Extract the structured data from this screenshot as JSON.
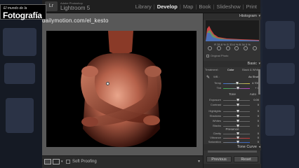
{
  "watermark": {
    "small": "El mundo de la",
    "big": "Fotografía"
  },
  "app": {
    "brand_small": "Adobe Photoshop",
    "brand": "Lightroom 5",
    "logo": "Lr"
  },
  "modules": [
    "Library",
    "Develop",
    "Map",
    "Book",
    "Slideshow",
    "Print"
  ],
  "active_module": "Develop",
  "photo": {
    "overlay_text": "dailymotion.com/el_kesto"
  },
  "toolbar": {
    "soft_proofing": "Soft Proofing"
  },
  "panel": {
    "histogram_header": "Histogram",
    "histogram_readout": "R  33.8 %   G  33.6 %   B  34.3 %",
    "original_photo": "Original Photo",
    "basic_header": "Basic",
    "treatment": {
      "label": "Treatment :",
      "color": "Color",
      "bw": "Black & White"
    },
    "wb": {
      "label": "WB :",
      "value": "As Shot"
    },
    "temp": {
      "label": "Temp",
      "value": "4.700"
    },
    "tint": {
      "label": "Tint",
      "value": "+ 1"
    },
    "tone": {
      "label": "Tone",
      "auto": "Auto"
    },
    "exposure": {
      "label": "Exposure",
      "value": "0.00"
    },
    "contrast": {
      "label": "Contrast",
      "value": "0"
    },
    "highlights": {
      "label": "Highlights",
      "value": "0"
    },
    "shadows": {
      "label": "Shadows",
      "value": "0"
    },
    "whites": {
      "label": "Whites",
      "value": "0"
    },
    "blacks": {
      "label": "Blacks",
      "value": "0"
    },
    "presence": "Presence",
    "clarity": {
      "label": "Clarity",
      "value": "0"
    },
    "vibrance": {
      "label": "Vibrance",
      "value": "0"
    },
    "saturation": {
      "label": "Saturation",
      "value": "0"
    },
    "tone_curve": "Tone Curve",
    "previous": "Previous",
    "reset": "Reset"
  },
  "colors": {
    "accent": "#eeeeee",
    "panel_bg": "#333333",
    "canvas_bg": "#585858"
  }
}
